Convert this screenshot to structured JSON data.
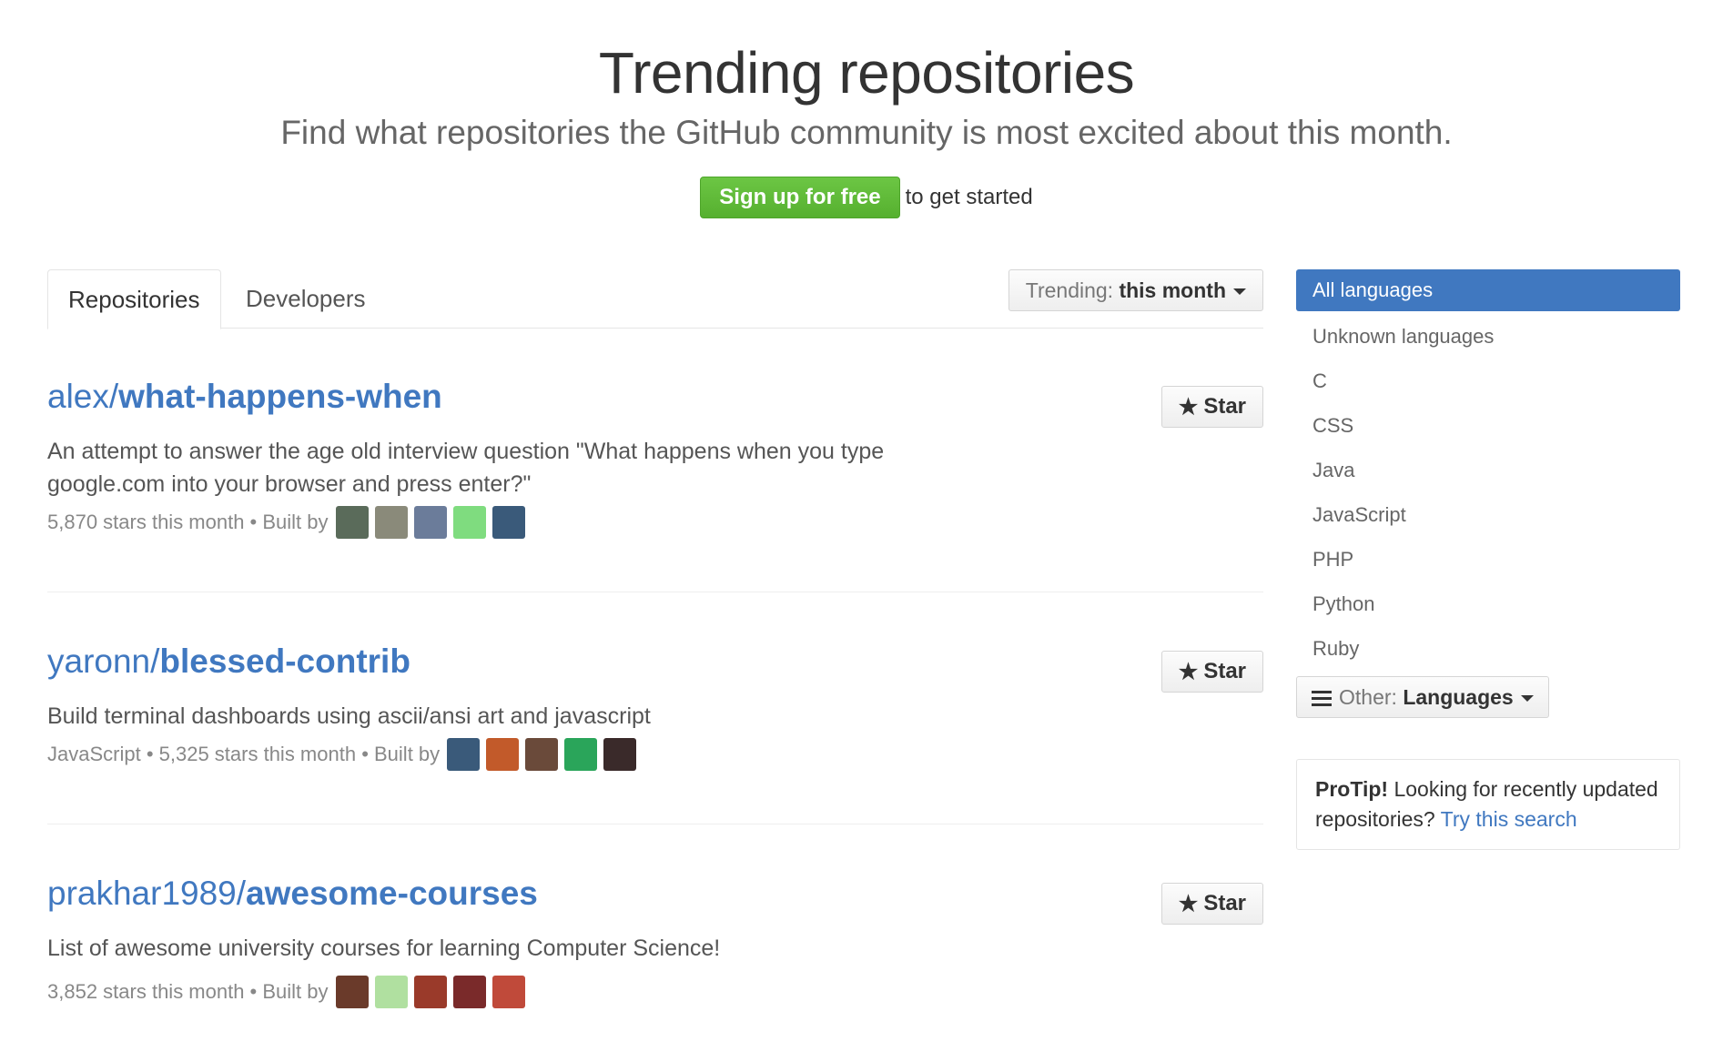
{
  "hero": {
    "title": "Trending repositories",
    "subtitle": "Find what repositories the GitHub community is most excited about this month.",
    "signup_label": "Sign up for free",
    "signup_tail": "to get started"
  },
  "tabs": [
    {
      "label": "Repositories",
      "selected": true
    },
    {
      "label": "Developers",
      "selected": false
    }
  ],
  "period": {
    "prefix": "Trending:",
    "value": "this month"
  },
  "repos": [
    {
      "owner": "alex/",
      "name": "what-happens-when",
      "description": "An attempt to answer the age old interview question \"What happens when you type google.com into your browser and press enter?\"",
      "meta": "5,870 stars this month • Built by",
      "star_label": "Star"
    },
    {
      "owner": "yaronn/",
      "name": "blessed-contrib",
      "description": "Build terminal dashboards using ascii/ansi art and javascript",
      "meta": "JavaScript • 5,325 stars this month • Built by",
      "star_label": "Star"
    },
    {
      "owner": "prakhar1989/",
      "name": "awesome-courses",
      "description": "List of awesome university courses for learning Computer Science!",
      "meta": "3,852 stars this month • Built by",
      "star_label": "Star"
    }
  ],
  "avatar_colors": [
    [
      "#5a6b5a",
      "#8a8a7a",
      "#6b7c9a",
      "#7fdc7f",
      "#3a5a7a"
    ],
    [
      "#3a5a7a",
      "#c25a2a",
      "#6a4a3a",
      "#2aa55a",
      "#3a2a2a"
    ],
    [
      "#6a3a2a",
      "#b0e0a0",
      "#9a3a2a",
      "#7a2a2a",
      "#c04a3a"
    ]
  ],
  "sidebar": {
    "languages": [
      {
        "label": "All languages",
        "selected": true
      },
      {
        "label": "Unknown languages",
        "selected": false
      },
      {
        "label": "C",
        "selected": false
      },
      {
        "label": "CSS",
        "selected": false
      },
      {
        "label": "Java",
        "selected": false
      },
      {
        "label": "JavaScript",
        "selected": false
      },
      {
        "label": "PHP",
        "selected": false
      },
      {
        "label": "Python",
        "selected": false
      },
      {
        "label": "Ruby",
        "selected": false
      }
    ],
    "other_prefix": "Other:",
    "other_value": "Languages",
    "protip_bold": "ProTip!",
    "protip_text": " Looking for recently updated repositories? ",
    "protip_link": "Try this search"
  },
  "colors": {
    "accent": "#4078c0",
    "signup_green": "#6cc644"
  }
}
